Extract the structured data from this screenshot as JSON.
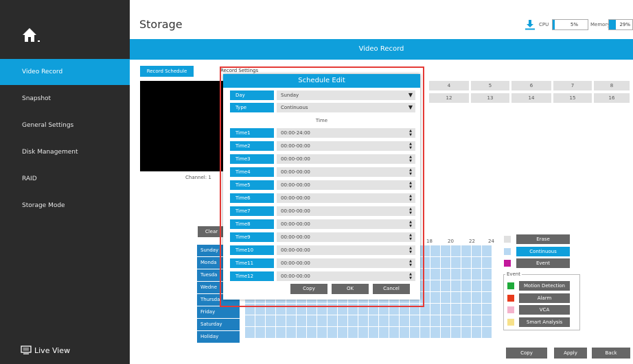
{
  "sidebar": {
    "items": [
      {
        "label": "Video Record"
      },
      {
        "label": "Snapshot"
      },
      {
        "label": "General Settings"
      },
      {
        "label": "Disk Management"
      },
      {
        "label": "RAID"
      },
      {
        "label": "Storage Mode"
      }
    ],
    "live_view": "Live View",
    "home_icon": "home-icon",
    "accent": "#0f9fdb",
    "background": "#2b2b2b"
  },
  "header": {
    "title": "Storage",
    "cpu_label": "CPU",
    "cpu_value": "5%",
    "cpu_fraction": 0.05,
    "memory_label": "Memory",
    "memory_value": "29%",
    "memory_fraction": 0.29
  },
  "section_title": "Video Record",
  "tabs": {
    "record_schedule": "Record Schedule",
    "record_settings": "Record Settings"
  },
  "preview": {
    "channel": "Channel: 1"
  },
  "channels_row1": [
    "4",
    "5",
    "6",
    "7",
    "8"
  ],
  "channels_row2": [
    "12",
    "13",
    "14",
    "15",
    "16"
  ],
  "schedule": {
    "clear": "Clear",
    "days": [
      "Sunday",
      "Monda",
      "Tuesda",
      "Wedne",
      "Thursda",
      "Friday",
      "Saturday",
      "Holiday"
    ],
    "hours": [
      "18",
      "20",
      "22",
      "24"
    ]
  },
  "legend": {
    "erase": "Erase",
    "continuous": "Continuous",
    "event": "Event",
    "event_group": "Event",
    "motion": "Motion Detection",
    "alarm": "Alarm",
    "vca": "VCA",
    "smart": "Smart Analysis",
    "colors": {
      "erase": "#e0e0e0",
      "continuous": "#b8d8f2",
      "event": "#c2189b",
      "motion": "#1faa3a",
      "alarm": "#e83b1c",
      "vca": "#f4b3cc",
      "smart": "#f7e18a"
    }
  },
  "footer": {
    "copy": "Copy",
    "apply": "Apply",
    "back": "Back"
  },
  "modal": {
    "title": "Schedule Edit",
    "day_label": "Day",
    "day_value": "Sunday",
    "type_label": "Type",
    "type_value": "Continuous",
    "time_heading": "Time",
    "times": [
      {
        "label": "Time1",
        "value": "00:00-24:00"
      },
      {
        "label": "Time2",
        "value": "00:00-00:00"
      },
      {
        "label": "Time3",
        "value": "00:00-00:00"
      },
      {
        "label": "Time4",
        "value": "00:00-00:00"
      },
      {
        "label": "Time5",
        "value": "00:00-00:00"
      },
      {
        "label": "Time6",
        "value": "00:00-00:00"
      },
      {
        "label": "Time7",
        "value": "00:00-00:00"
      },
      {
        "label": "Time8",
        "value": "00:00-00:00"
      },
      {
        "label": "Time9",
        "value": "00:00-00:00"
      },
      {
        "label": "Time10",
        "value": "00:00-00:00"
      },
      {
        "label": "Time11",
        "value": "00:00-00:00"
      },
      {
        "label": "Time12",
        "value": "00:00-00:00"
      }
    ],
    "copy": "Copy",
    "ok": "OK",
    "cancel": "Cancel"
  }
}
